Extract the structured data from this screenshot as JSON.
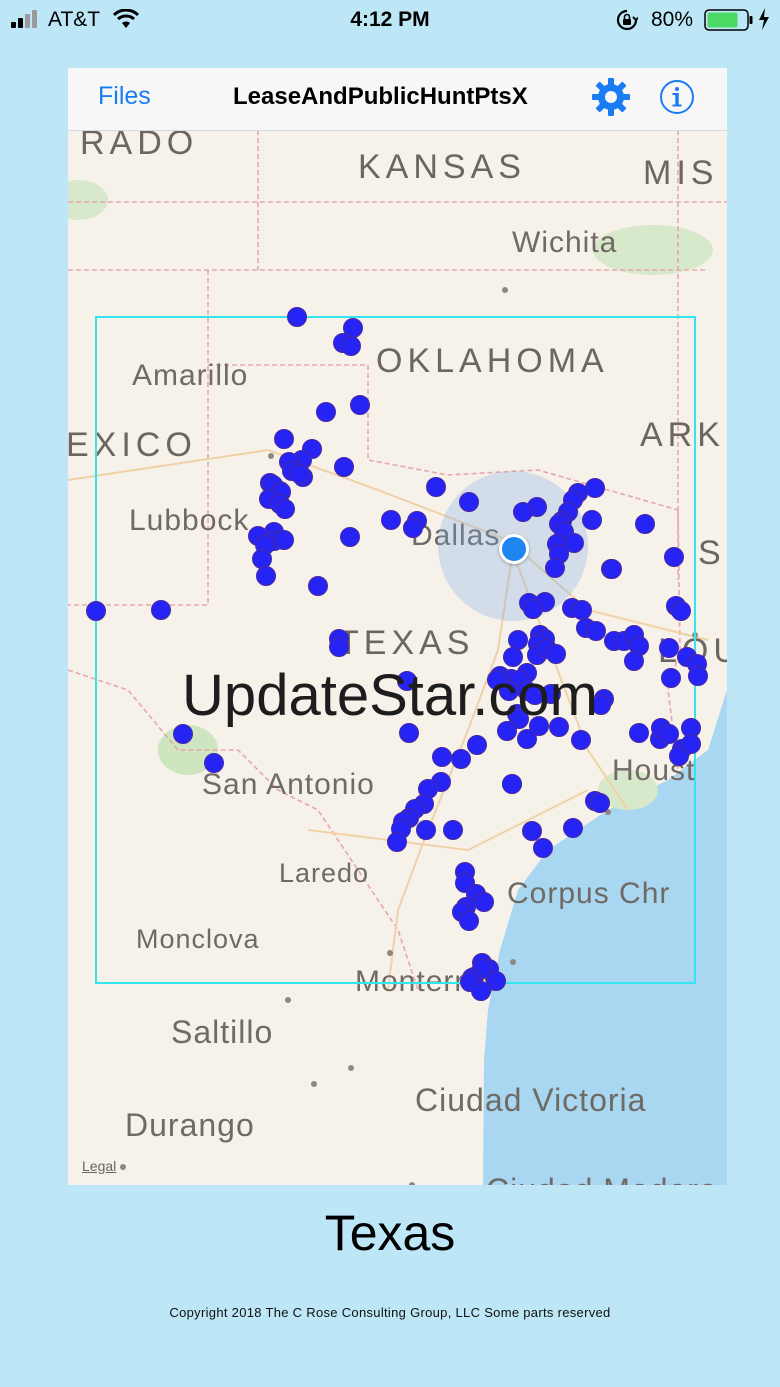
{
  "status_bar": {
    "carrier": "AT&T",
    "time": "4:12 PM",
    "battery_percent": "80%",
    "battery_level": 0.8,
    "icons": [
      "signal-icon",
      "wifi-icon",
      "orientation-lock-icon",
      "battery-icon",
      "charging-bolt-icon"
    ]
  },
  "navbar": {
    "files_label": "Files",
    "title": "LeaseAndPublicHuntPtsX",
    "settings_icon": "gear-icon",
    "info_icon": "info-icon"
  },
  "map": {
    "labels": {
      "colorado": "RADO",
      "kansas": "KANSAS",
      "missouri": "MIS",
      "wichita": "Wichita",
      "oklahoma": "OKLAHOMA",
      "amarillo": "Amarillo",
      "new_mexico": "EXICO",
      "arkansas": "ARK",
      "lubbock": "Lubbock",
      "dallas": "Dallas",
      "shreveport": "Sh",
      "texas": "TEXAS",
      "louisiana": "LOUI",
      "san_antonio": "San Antonio",
      "houston": "Houst",
      "laredo": "Laredo",
      "corpus_christi": "Corpus Chr",
      "monclova": "Monclova",
      "monterrey": "Monterrey",
      "saltillo": "Saltillo",
      "ciudad_victoria": "Ciudad Victoria",
      "durango": "Durango",
      "ciudad_madero": "Ciudad Madero"
    },
    "legal_label": "Legal",
    "colors": {
      "point": "#2623f5",
      "bounding_box": "#33e5ee",
      "user_location": "#1f86f0",
      "water": "#a9d6f0",
      "land": "#f6f2ea"
    }
  },
  "watermark": "UpdateStar.com",
  "region_name": "Texas",
  "copyright": "Copyright 2018 The C Rose Consulting Group, LLC  Some parts reserved"
}
